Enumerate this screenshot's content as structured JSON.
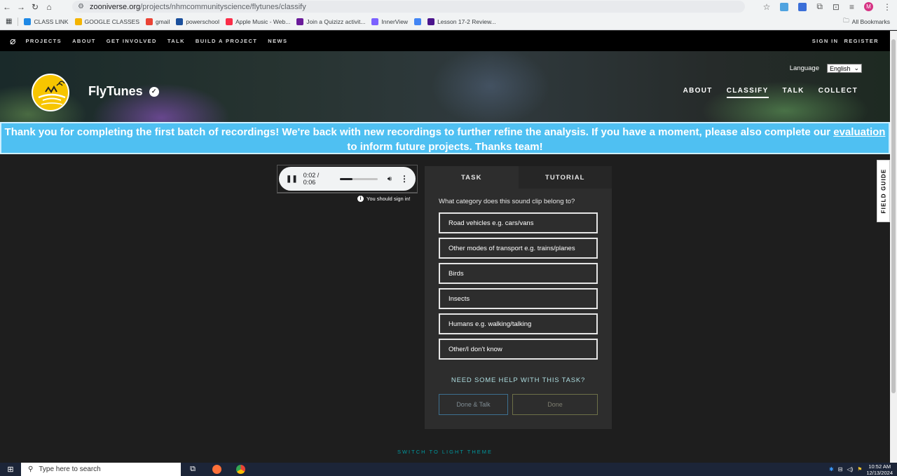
{
  "browser": {
    "url_host": "zooniverse.org",
    "url_path": "/projects/nhmcommunityscience/flytunes/classify",
    "profile_initial": "M",
    "bookmarks": [
      {
        "label": "CLASS LINK",
        "color": "#1e88e5"
      },
      {
        "label": "GOOGLE CLASSES",
        "color": "#f4b400"
      },
      {
        "label": "gmail",
        "color": "#ea4335"
      },
      {
        "label": "powerschool",
        "color": "#1a4f9c"
      },
      {
        "label": "Apple Music - Web...",
        "color": "#fa2d48"
      },
      {
        "label": "Join a Quizizz activit...",
        "color": "#6a1b9a"
      },
      {
        "label": "InnerView",
        "color": "#7b61ff"
      },
      {
        "label": "",
        "color": "#4285f4"
      },
      {
        "label": "Lesson 17-2 Review...",
        "color": "#4a148c"
      }
    ],
    "all_bookmarks": "All Bookmarks"
  },
  "zoo_nav": {
    "links": [
      "PROJECTS",
      "ABOUT",
      "GET INVOLVED",
      "TALK",
      "BUILD A PROJECT",
      "NEWS"
    ],
    "sign_in": "SIGN IN",
    "register": "REGISTER"
  },
  "project": {
    "title": "FlyTunes",
    "language_label": "Language",
    "language_value": "English",
    "nav": [
      "ABOUT",
      "CLASSIFY",
      "TALK",
      "COLLECT"
    ],
    "active_nav": "CLASSIFY"
  },
  "announcement": {
    "before": "Thank you for completing the first batch of recordings! We're back with new recordings to further refine the analysis. If you have a moment, please also complete our ",
    "link": "evaluation",
    "after": " to inform future projects. Thanks team!"
  },
  "audio": {
    "time": "0:02 / 0:06",
    "progress_fraction": 0.33,
    "signin_note": "You should sign in!"
  },
  "task": {
    "tabs": [
      "TASK",
      "TUTORIAL"
    ],
    "question": "What category does this sound clip belong to?",
    "answers": [
      "Road vehicles e.g. cars/vans",
      "Other modes of transport e.g. trains/planes",
      "Birds",
      "Insects",
      "Humans e.g. walking/talking",
      "Other/I don't know"
    ],
    "help": "NEED SOME HELP WITH THIS TASK?",
    "done_talk": "Done & Talk",
    "done": "Done"
  },
  "field_guide": "FIELD GUIDE",
  "theme_switch": "SWITCH TO LIGHT THEME",
  "taskbar": {
    "search_placeholder": "Type here to search",
    "time": "10:52 AM",
    "date": "12/13/2024"
  }
}
